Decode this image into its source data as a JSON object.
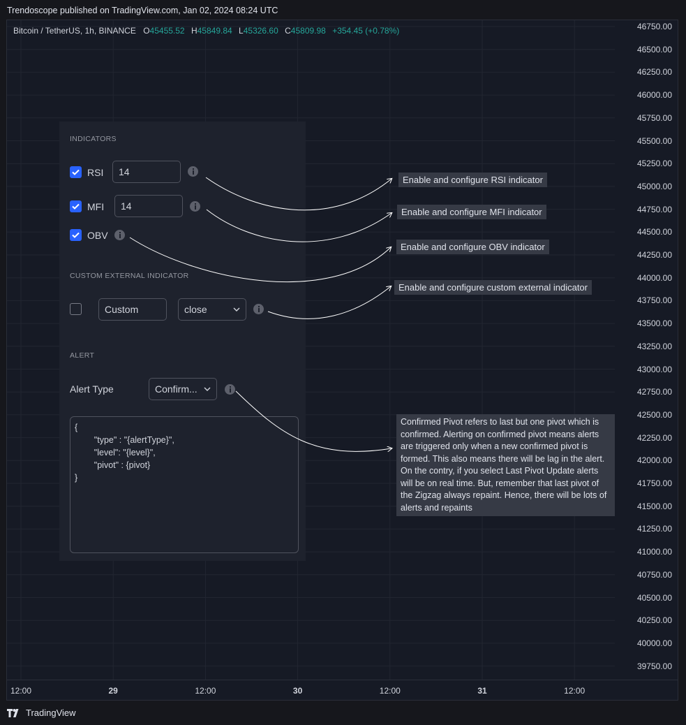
{
  "header": {
    "published": "Trendoscope published on TradingView.com, Jan 02, 2024 08:24 UTC"
  },
  "symbol": {
    "name": "Bitcoin / TetherUS, 1h, BINANCE",
    "o_label": "O",
    "o": "45455.52",
    "h_label": "H",
    "h": "45849.84",
    "l_label": "L",
    "l": "45326.60",
    "c_label": "C",
    "c": "45809.98",
    "change": "+354.45 (+0.78%)"
  },
  "colors": {
    "up": "#26a69a",
    "accent": "#2962ff",
    "panel": "#1e222d",
    "tooltip": "#363a45"
  },
  "price_axis": [
    "46750.00",
    "46500.00",
    "46250.00",
    "46000.00",
    "45750.00",
    "45500.00",
    "45250.00",
    "45000.00",
    "44750.00",
    "44500.00",
    "44250.00",
    "44000.00",
    "43750.00",
    "43500.00",
    "43250.00",
    "43000.00",
    "42750.00",
    "42500.00",
    "42250.00",
    "42000.00",
    "41750.00",
    "41500.00",
    "41250.00",
    "41000.00",
    "40750.00",
    "40500.00",
    "40250.00",
    "40000.00",
    "39750.00"
  ],
  "time_axis": [
    {
      "label": "12:00",
      "bold": false
    },
    {
      "label": "29",
      "bold": true
    },
    {
      "label": "12:00",
      "bold": false
    },
    {
      "label": "30",
      "bold": true
    },
    {
      "label": "12:00",
      "bold": false
    },
    {
      "label": "31",
      "bold": true
    },
    {
      "label": "12:00",
      "bold": false
    }
  ],
  "panel": {
    "indicators_title": "INDICATORS",
    "rsi": {
      "label": "RSI",
      "value": "14",
      "checked": true
    },
    "mfi": {
      "label": "MFI",
      "value": "14",
      "checked": true
    },
    "obv": {
      "label": "OBV",
      "checked": true
    },
    "custom_title": "CUSTOM EXTERNAL INDICATOR",
    "custom": {
      "checked": false,
      "name": "Custom",
      "source": "close"
    },
    "alert_title": "ALERT",
    "alert_type_label": "Alert Type",
    "alert_type_value": "Confirm...",
    "alert_template": "{\n        \"type\" : \"{alertType}\",\n        \"level\": \"{level}\",\n        \"pivot\" : {pivot}\n}"
  },
  "tooltips": {
    "rsi": "Enable and configure RSI indicator",
    "mfi": "Enable and configure MFI indicator",
    "obv": "Enable and configure OBV indicator",
    "custom": "Enable and configure custom external indicator",
    "alert": "Confirmed Pivot refers to last but one pivot which is confirmed. Alerting on confirmed pivot means alerts are triggered only when a new confirmed pivot is formed. This also means there will be lag in the alert. On the contry, if you select Last Pivot Update alerts will be on real time. But, remember that last pivot of the Zigzag always repaint. Hence, there will be lots of alerts and repaints"
  },
  "footer": {
    "brand": "TradingView",
    "logo_icon": "tradingview-logo-icon"
  }
}
